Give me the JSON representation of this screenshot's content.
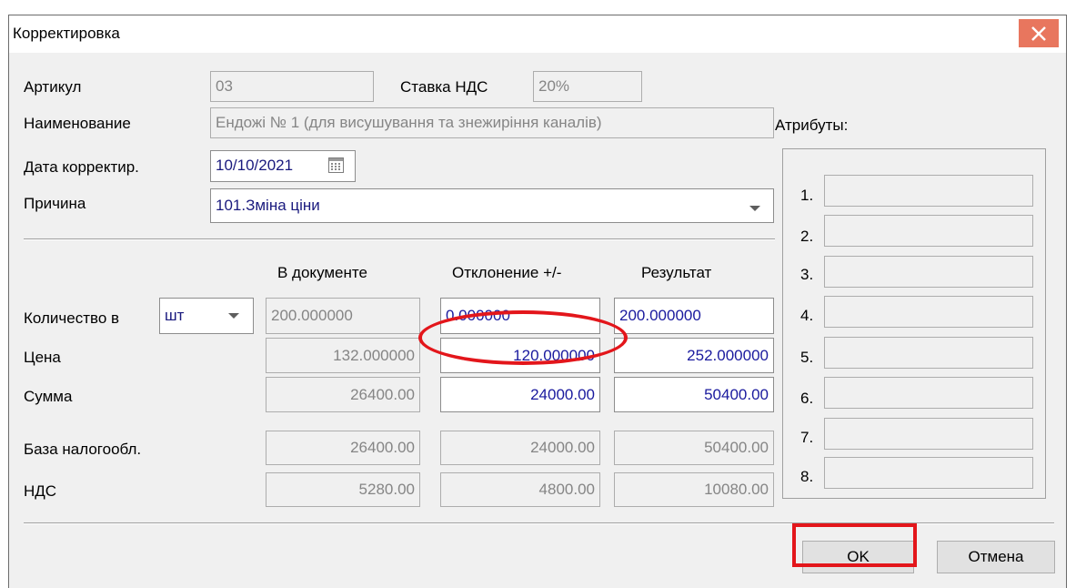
{
  "window": {
    "title": "Корректировка",
    "close_glyph": "✕"
  },
  "header": {
    "article_label": "Артикул",
    "article_value": "03",
    "vat_rate_label": "Ставка НДС",
    "vat_rate_value": "20%",
    "name_label": "Наименование",
    "name_value": "Ендожі № 1 (для висушування та знежиріння каналів)",
    "date_label": "Дата корректир.",
    "date_value": "10/10/2021",
    "reason_label": "Причина",
    "reason_value": "101.Зміна ціни"
  },
  "columns": {
    "in_document": "В документе",
    "deviation": "Отклонение +/-",
    "result": "Результат"
  },
  "rows": {
    "quantity": {
      "label": "Количество в",
      "unit": "шт",
      "in_document": "200.000000",
      "deviation": "0.000000",
      "result": "200.000000"
    },
    "price": {
      "label": "Цена",
      "in_document": "132.000000",
      "deviation": "120.000000",
      "result": "252.000000"
    },
    "sum": {
      "label": "Сумма",
      "in_document": "26400.00",
      "deviation": "24000.00",
      "result": "50400.00"
    },
    "tax_base": {
      "label": "База налогообл.",
      "in_document": "26400.00",
      "deviation": "24000.00",
      "result": "50400.00"
    },
    "vat": {
      "label": "НДС",
      "in_document": "5280.00",
      "deviation": "4800.00",
      "result": "10080.00"
    }
  },
  "attributes": {
    "label": "Атрибуты:",
    "items": [
      {
        "num": "1.",
        "value": ""
      },
      {
        "num": "2.",
        "value": ""
      },
      {
        "num": "3.",
        "value": ""
      },
      {
        "num": "4.",
        "value": ""
      },
      {
        "num": "5.",
        "value": ""
      },
      {
        "num": "6.",
        "value": ""
      },
      {
        "num": "7.",
        "value": ""
      },
      {
        "num": "8.",
        "value": ""
      }
    ]
  },
  "buttons": {
    "ok": "OK",
    "cancel": "Отмена"
  },
  "colors": {
    "title_close_bg": "#e8765e",
    "highlight": "#e3161b",
    "edit_text": "#1a1a9e"
  }
}
